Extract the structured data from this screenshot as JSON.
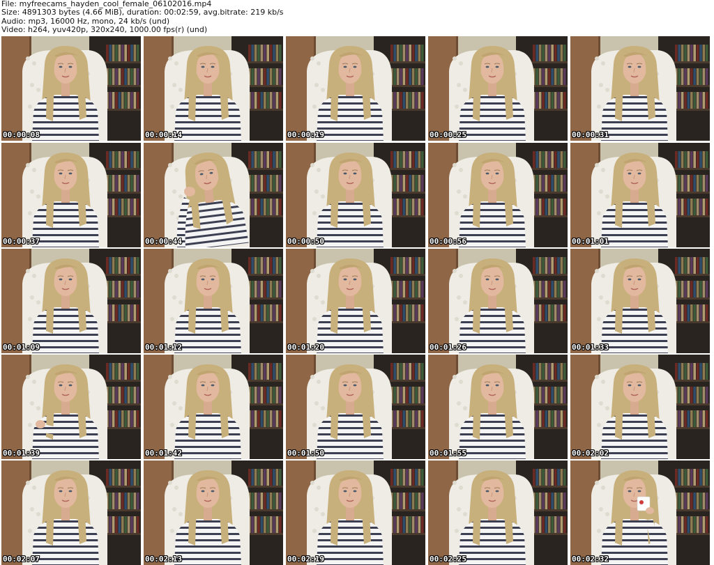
{
  "header": {
    "file": "File: myfreecams_hayden_cool_female_06102016.mp4",
    "size": "Size: 4891303 bytes (4.66 MiB), duration: 00:02:59, avg.bitrate: 219 kb/s",
    "audio": "Audio: mp3, 16000 Hz, mono, 24 kb/s (und)",
    "video": "Video: h264, yuv420p, 320x240, 1000.00 fps(r) (und)"
  },
  "colors": {
    "wall": "#c9c3ae",
    "door": "#8f6646",
    "shelf": "#2a2420",
    "chair": "#eeece4",
    "hair": "#c8b07c",
    "skin": "#e2b99e",
    "shirt": "#f4f4f4",
    "stripe": "#3c3f52"
  },
  "frames": [
    {
      "time": "00:00:08",
      "pose": "normal"
    },
    {
      "time": "00:00:14",
      "pose": "normal"
    },
    {
      "time": "00:00:19",
      "pose": "normal"
    },
    {
      "time": "00:00:25",
      "pose": "normal"
    },
    {
      "time": "00:00:31",
      "pose": "normal"
    },
    {
      "time": "00:00:37",
      "pose": "normal"
    },
    {
      "time": "00:00:44",
      "pose": "hand-in-hair"
    },
    {
      "time": "00:00:50",
      "pose": "normal"
    },
    {
      "time": "00:00:56",
      "pose": "normal"
    },
    {
      "time": "00:01:01",
      "pose": "normal"
    },
    {
      "time": "00:01:09",
      "pose": "normal"
    },
    {
      "time": "00:01:12",
      "pose": "normal"
    },
    {
      "time": "00:01:20",
      "pose": "normal"
    },
    {
      "time": "00:01:26",
      "pose": "normal"
    },
    {
      "time": "00:01:33",
      "pose": "normal"
    },
    {
      "time": "00:01:39",
      "pose": "arm-crossed"
    },
    {
      "time": "00:01:42",
      "pose": "normal"
    },
    {
      "time": "00:01:50",
      "pose": "normal"
    },
    {
      "time": "00:01:55",
      "pose": "normal"
    },
    {
      "time": "00:02:02",
      "pose": "normal"
    },
    {
      "time": "00:02:07",
      "pose": "normal"
    },
    {
      "time": "00:02:13",
      "pose": "normal"
    },
    {
      "time": "00:02:19",
      "pose": "normal"
    },
    {
      "time": "00:02:25",
      "pose": "normal"
    },
    {
      "time": "00:02:32",
      "pose": "drinking"
    }
  ]
}
